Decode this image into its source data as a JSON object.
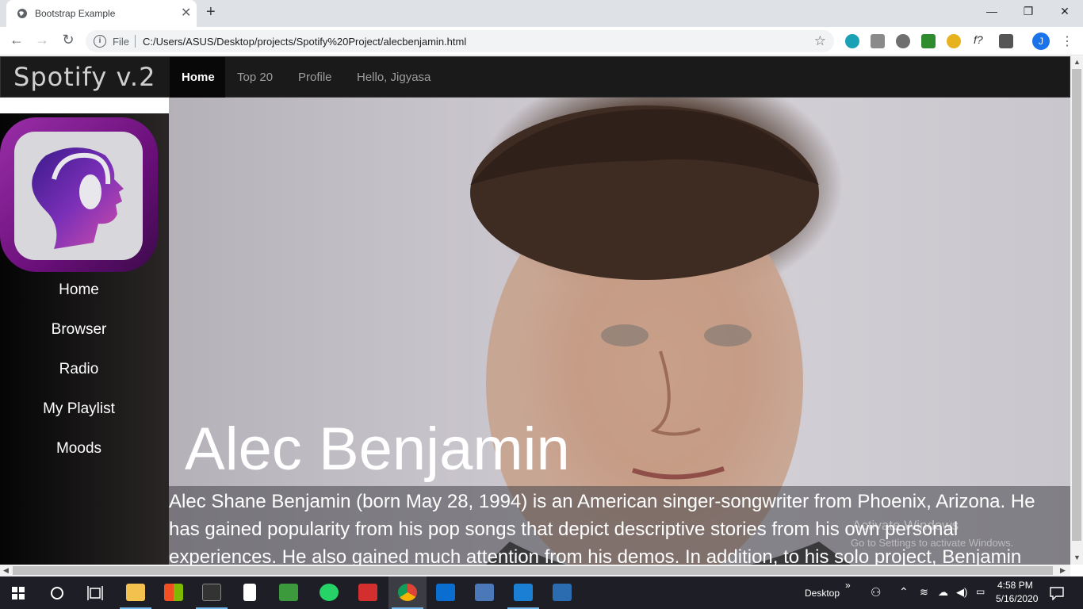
{
  "browser": {
    "tab_title": "Bootstrap Example",
    "tab_close": "✕",
    "new_tab": "+",
    "window_controls": {
      "minimize": "—",
      "restore": "❐",
      "close": "✕"
    },
    "nav": {
      "back": "←",
      "forward": "→",
      "reload": "↻"
    },
    "omnibox": {
      "info_icon": "i",
      "scheme_label": "File",
      "url": "C:/Users/ASUS/Desktop/projects/Spotify%20Project/alecbenjamin.html",
      "star": "☆"
    },
    "extension_text": "f?",
    "profile_initial": "J",
    "menu": "⋮"
  },
  "navbar": {
    "brand": "Spotify v.2",
    "links": [
      "Home",
      "Top 20",
      "Profile",
      "Hello, Jigyasa"
    ],
    "active_link": "Home"
  },
  "sidebar": {
    "links": [
      "Home",
      "Browser",
      "Radio",
      "My Playlist",
      "Moods"
    ]
  },
  "hero": {
    "name": "Alec Benjamin",
    "bio_lines": [
      "Alec Shane Benjamin (born May 28, 1994) is an American singer-songwriter from Phoenix, Arizona. He",
      "has gained popularity from his pop songs that depict descriptive stories from his own personal",
      "experiences. He also gained much attention from his demos. In addition, to his solo project, Benjamin"
    ]
  },
  "watermark": {
    "line1": "Activate Windows",
    "line2": "Go to Settings to activate Windows."
  },
  "taskbar": {
    "desktop_label": "Desktop",
    "chevron": "»",
    "time": "4:58 PM",
    "date": "5/16/2020"
  },
  "colors": {
    "navbar_bg": "#1a1a1a",
    "logo_gradient_start": "#9a2ea8",
    "taskbar_bg": "#1e1f26",
    "active_underline": "#76b9ed"
  }
}
